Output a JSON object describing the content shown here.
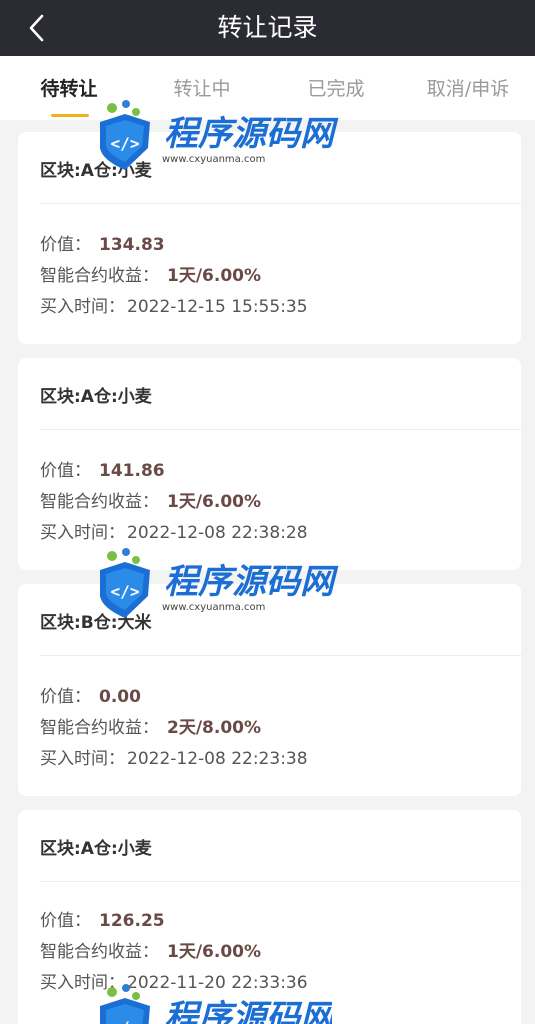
{
  "header": {
    "title": "转让记录"
  },
  "tabs": [
    {
      "label": "待转让"
    },
    {
      "label": "转让中"
    },
    {
      "label": "已完成"
    },
    {
      "label": "取消/申诉"
    }
  ],
  "labels": {
    "value": "价值：",
    "yield": "智能合约收益：",
    "buy_time": "买入时间："
  },
  "records": [
    {
      "title": "区块:A仓:小麦",
      "value": "134.83",
      "yield": "1天/6.00%",
      "buy_time": "2022-12-15 15:55:35"
    },
    {
      "title": "区块:A仓:小麦",
      "value": "141.86",
      "yield": "1天/6.00%",
      "buy_time": "2022-12-08 22:38:28"
    },
    {
      "title": "区块:B仓:大米",
      "value": "0.00",
      "yield": "2天/8.00%",
      "buy_time": "2022-12-08 22:23:38"
    },
    {
      "title": "区块:A仓:小麦",
      "value": "126.25",
      "yield": "1天/6.00%",
      "buy_time": "2022-11-20 22:33:36"
    }
  ],
  "watermark": {
    "text": "程序源码网",
    "url": "www.cxyuanma.com"
  }
}
